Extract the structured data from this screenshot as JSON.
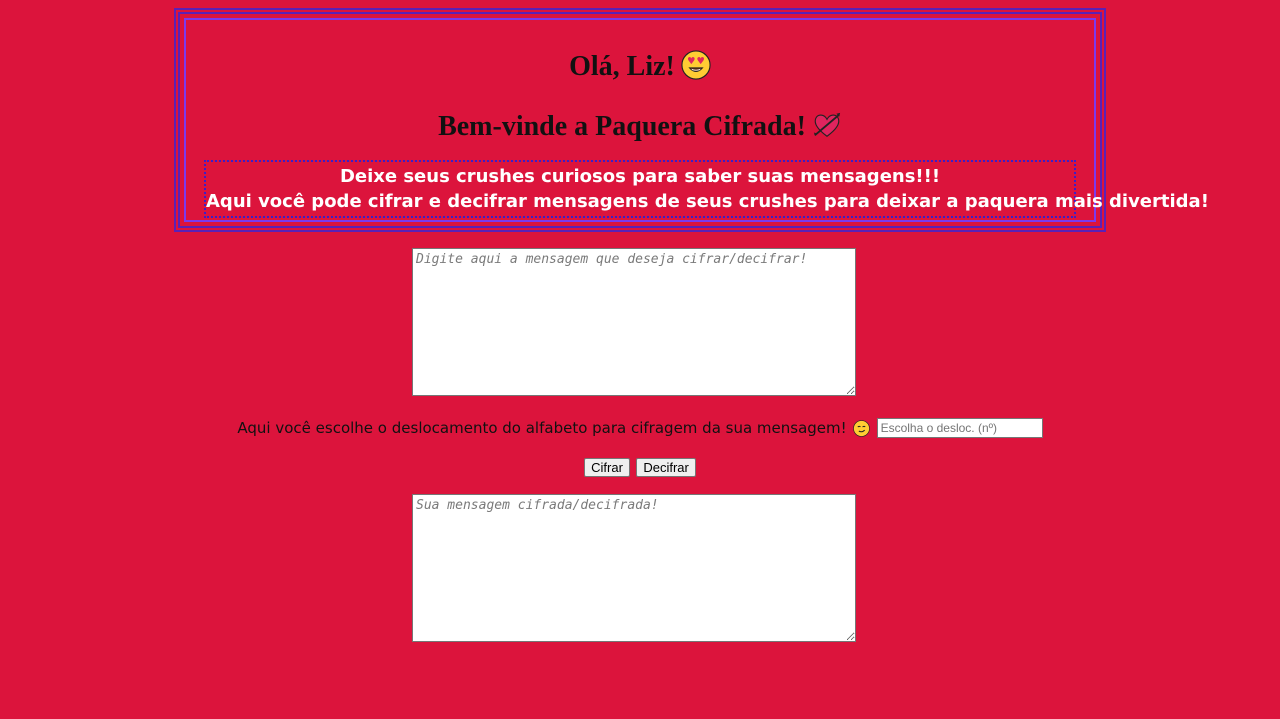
{
  "header": {
    "greeting": "Olá, Liz!",
    "welcome": "Bem-vinde a Paquera Cifrada!",
    "intro_line1": "Deixe seus crushes curiosos para saber suas mensagens!!!",
    "intro_line2": "Aqui você pode cifrar e decifrar mensagens de seus crushes para deixar a paquera mais divertida!"
  },
  "input_message": {
    "placeholder": "Digite aqui a mensagem que deseja cifrar/decifrar!",
    "value": ""
  },
  "shift": {
    "label": "Aqui você escolhe o deslocamento do alfabeto para cifragem da sua mensagem!",
    "placeholder": "Escolha o desloc. (nº)",
    "value": ""
  },
  "buttons": {
    "encrypt_label": "Cifrar",
    "decrypt_label": "Decifrar"
  },
  "output_message": {
    "placeholder": "Sua mensagem cifrada/decifrada!",
    "value": ""
  },
  "icons": {
    "greeting": "heart-eyes-emoji-icon",
    "welcome": "heart-with-arrow-icon",
    "shift": "smirk-emoji-icon"
  },
  "colors": {
    "background": "#dc143c",
    "frame": "#5b21b6",
    "intro_border": "#3b1ec9"
  }
}
